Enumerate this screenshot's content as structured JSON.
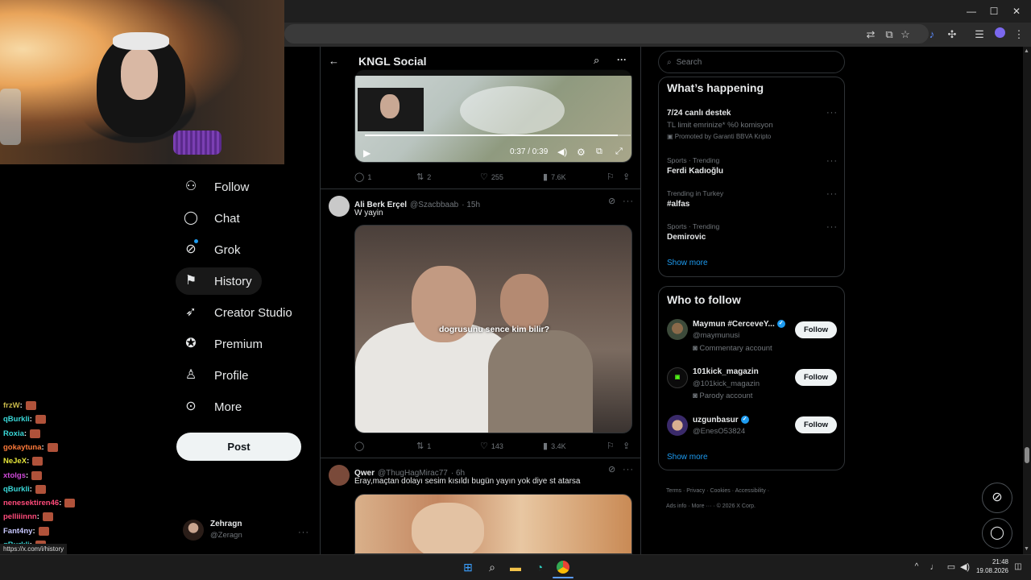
{
  "browser": {
    "window_controls": [
      "—",
      "☐",
      "✕"
    ]
  },
  "chat": {
    "lines": [
      {
        "user": "frzW",
        "color": "#c8b84a"
      },
      {
        "user": "qBurkli",
        "color": "#3ad9d9"
      },
      {
        "user": "Roxia",
        "color": "#3ad9d9"
      },
      {
        "user": "gokaytuna",
        "color": "#ff7a3a"
      },
      {
        "user": "NeJeX",
        "color": "#e6e63a"
      },
      {
        "user": "xtolgs",
        "color": "#d04ad9"
      },
      {
        "user": "qBurkli",
        "color": "#3ad9d9"
      },
      {
        "user": "nenesektiren46",
        "color": "#ff4a7a"
      },
      {
        "user": "pelliiinnn",
        "color": "#ff4a7a"
      },
      {
        "user": "Fant4ny",
        "color": "#c8c8ff"
      },
      {
        "user": "qBurkli",
        "color": "#3ad9d9"
      },
      {
        "user": "alperenok_08",
        "color": "#ffb347"
      }
    ],
    "status_url": "https://x.com/i/history"
  },
  "nav": {
    "items": [
      {
        "label": "Follow",
        "icon": "person-plus-icon"
      },
      {
        "label": "Chat",
        "icon": "chat-bubble-icon"
      },
      {
        "label": "Grok",
        "icon": "grok-icon"
      },
      {
        "label": "History",
        "icon": "history-bookmark-icon"
      },
      {
        "label": "Creator Studio",
        "icon": "rocket-icon"
      },
      {
        "label": "Premium",
        "icon": "verified-badge-icon"
      },
      {
        "label": "Profile",
        "icon": "person-icon"
      },
      {
        "label": "More",
        "icon": "more-circle-icon"
      }
    ],
    "post_label": "Post",
    "account": {
      "name": "Zehragn",
      "handle": "@Zeragn"
    }
  },
  "header": {
    "title": "KNGL Social"
  },
  "video1": {
    "time": "0:37 / 0:39",
    "progress": 0.95,
    "actions": {
      "replies": "1",
      "reposts": "2",
      "likes": "255",
      "views": "7.6K"
    }
  },
  "tweets": [
    {
      "name": "Ali Berk Erçel",
      "handle": "@Szacbbaab",
      "time": "· 15h",
      "text": "W yayin",
      "caption": "dogrusunu sence kim bilir?",
      "actions": {
        "replies": "",
        "reposts": "1",
        "likes": "143",
        "views": "3.4K"
      }
    },
    {
      "name": "Qwer",
      "handle": "@ThugHagMirac77",
      "time": "· 6h",
      "text": "Eray,maçtan dolayı sesim kısıldı bugün yayın yok diye st atarsa"
    }
  ],
  "search": {
    "placeholder": "Search"
  },
  "happening": {
    "title": "What’s happening",
    "items": [
      {
        "category": "",
        "name": "7/24 canlı destek",
        "sub": "TL limit emrinize* %0 komisyon",
        "promo": "Promoted by Garanti BBVA Kripto"
      },
      {
        "category": "Sports · Trending",
        "name": "Ferdi Kadıoğlu"
      },
      {
        "category": "Trending in Turkey",
        "name": "#alfas"
      },
      {
        "category": "Sports · Trending",
        "name": "Demirovic"
      }
    ],
    "show_more": "Show more"
  },
  "who_to_follow": {
    "title": "Who to follow",
    "items": [
      {
        "name": "Maymun #CerceveY...",
        "handle": "@maymunusi",
        "sub": "Commentary account",
        "verified": true
      },
      {
        "name": "101kick_magazin",
        "handle": "@101kick_magazin",
        "sub": "Parody account",
        "verified": false
      },
      {
        "name": "uzgunbasur",
        "handle": "@EnesO53824",
        "sub": "",
        "verified": true
      }
    ],
    "follow_label": "Follow",
    "show_more": "Show more"
  },
  "footer": {
    "links": [
      "Terms",
      "Privacy",
      "Cookies",
      "Accessibility",
      "Ads info",
      "More ···",
      "© 2026 X Corp."
    ]
  },
  "taskbar": {
    "time": "21:48",
    "date": "19.08.2026"
  }
}
